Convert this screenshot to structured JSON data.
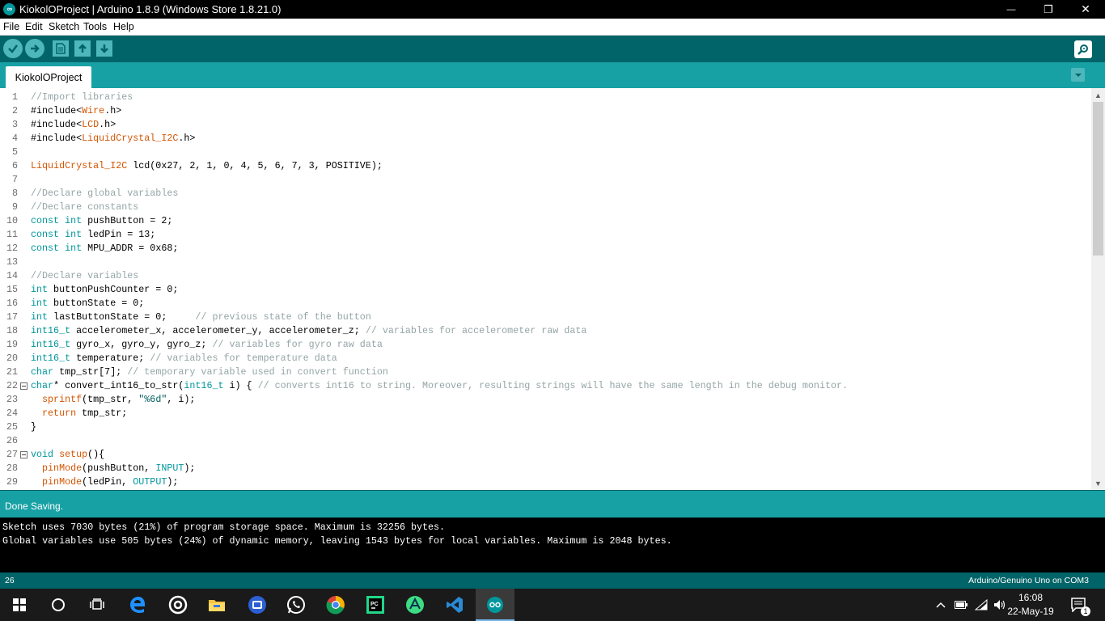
{
  "window": {
    "title": "KiokolOProject | Arduino 1.8.9 (Windows Store 1.8.21.0)",
    "logo_text": "∞",
    "minimize": "—",
    "restore": "❐",
    "close": "✕"
  },
  "menu": [
    "File",
    "Edit",
    "Sketch",
    "Tools",
    "Help"
  ],
  "tab": {
    "label": "KiokolOProject"
  },
  "colors": {
    "teal_dark": "#006468",
    "teal": "#17a1a5",
    "keyword": "#00979c",
    "function": "#d35400",
    "comment": "#95a5a6"
  },
  "code_lines": [
    {
      "n": "1",
      "tokens": [
        {
          "c": "com",
          "t": "//Import libraries"
        }
      ]
    },
    {
      "n": "2",
      "tokens": [
        {
          "c": "",
          "t": "#include<"
        },
        {
          "c": "fn",
          "t": "Wire"
        },
        {
          "c": "",
          "t": ".h>"
        }
      ]
    },
    {
      "n": "3",
      "tokens": [
        {
          "c": "",
          "t": "#include<"
        },
        {
          "c": "fn",
          "t": "LCD"
        },
        {
          "c": "",
          "t": ".h>"
        }
      ]
    },
    {
      "n": "4",
      "tokens": [
        {
          "c": "",
          "t": "#include<"
        },
        {
          "c": "fn",
          "t": "LiquidCrystal_I2C"
        },
        {
          "c": "",
          "t": ".h>"
        }
      ]
    },
    {
      "n": "5",
      "tokens": []
    },
    {
      "n": "6",
      "tokens": [
        {
          "c": "fn",
          "t": "LiquidCrystal_I2C"
        },
        {
          "c": "",
          "t": " lcd(0x27, 2, 1, 0, 4, 5, 6, 7, 3, POSITIVE);"
        }
      ]
    },
    {
      "n": "7",
      "tokens": []
    },
    {
      "n": "8",
      "tokens": [
        {
          "c": "com",
          "t": "//Declare global variables"
        }
      ]
    },
    {
      "n": "9",
      "tokens": [
        {
          "c": "com",
          "t": "//Declare constants"
        }
      ]
    },
    {
      "n": "10",
      "tokens": [
        {
          "c": "kw",
          "t": "const"
        },
        {
          "c": "",
          "t": " "
        },
        {
          "c": "kw",
          "t": "int"
        },
        {
          "c": "",
          "t": " pushButton = 2;"
        }
      ]
    },
    {
      "n": "11",
      "tokens": [
        {
          "c": "kw",
          "t": "const"
        },
        {
          "c": "",
          "t": " "
        },
        {
          "c": "kw",
          "t": "int"
        },
        {
          "c": "",
          "t": " ledPin = 13;"
        }
      ]
    },
    {
      "n": "12",
      "tokens": [
        {
          "c": "kw",
          "t": "const"
        },
        {
          "c": "",
          "t": " "
        },
        {
          "c": "kw",
          "t": "int"
        },
        {
          "c": "",
          "t": " MPU_ADDR = 0x68;"
        }
      ]
    },
    {
      "n": "13",
      "tokens": []
    },
    {
      "n": "14",
      "tokens": [
        {
          "c": "com",
          "t": "//Declare variables"
        }
      ]
    },
    {
      "n": "15",
      "tokens": [
        {
          "c": "kw",
          "t": "int"
        },
        {
          "c": "",
          "t": " buttonPushCounter = 0;"
        }
      ]
    },
    {
      "n": "16",
      "tokens": [
        {
          "c": "kw",
          "t": "int"
        },
        {
          "c": "",
          "t": " buttonState = 0;"
        }
      ]
    },
    {
      "n": "17",
      "tokens": [
        {
          "c": "kw",
          "t": "int"
        },
        {
          "c": "",
          "t": " lastButtonState = 0;     "
        },
        {
          "c": "com",
          "t": "// previous state of the button"
        }
      ]
    },
    {
      "n": "18",
      "tokens": [
        {
          "c": "kw",
          "t": "int16_t"
        },
        {
          "c": "",
          "t": " accelerometer_x, accelerometer_y, accelerometer_z; "
        },
        {
          "c": "com",
          "t": "// variables for accelerometer raw data"
        }
      ]
    },
    {
      "n": "19",
      "tokens": [
        {
          "c": "kw",
          "t": "int16_t"
        },
        {
          "c": "",
          "t": " gyro_x, gyro_y, gyro_z; "
        },
        {
          "c": "com",
          "t": "// variables for gyro raw data"
        }
      ]
    },
    {
      "n": "20",
      "tokens": [
        {
          "c": "kw",
          "t": "int16_t"
        },
        {
          "c": "",
          "t": " temperature; "
        },
        {
          "c": "com",
          "t": "// variables for temperature data"
        }
      ]
    },
    {
      "n": "21",
      "tokens": [
        {
          "c": "kw",
          "t": "char"
        },
        {
          "c": "",
          "t": " tmp_str[7]; "
        },
        {
          "c": "com",
          "t": "// temporary variable used in convert function"
        }
      ]
    },
    {
      "n": "22",
      "fold": true,
      "tokens": [
        {
          "c": "kw",
          "t": "char"
        },
        {
          "c": "",
          "t": "* convert_int16_to_str("
        },
        {
          "c": "kw",
          "t": "int16_t"
        },
        {
          "c": "",
          "t": " i) { "
        },
        {
          "c": "com",
          "t": "// converts int16 to string. Moreover, resulting strings will have the same length in the debug monitor."
        }
      ]
    },
    {
      "n": "23",
      "tokens": [
        {
          "c": "",
          "t": "  "
        },
        {
          "c": "fn",
          "t": "sprintf"
        },
        {
          "c": "",
          "t": "(tmp_str, "
        },
        {
          "c": "str",
          "t": "\"%6d\""
        },
        {
          "c": "",
          "t": ", i);"
        }
      ]
    },
    {
      "n": "24",
      "tokens": [
        {
          "c": "",
          "t": "  "
        },
        {
          "c": "fn",
          "t": "return"
        },
        {
          "c": "",
          "t": " tmp_str;"
        }
      ]
    },
    {
      "n": "25",
      "tokens": [
        {
          "c": "",
          "t": "}"
        }
      ]
    },
    {
      "n": "26",
      "tokens": []
    },
    {
      "n": "27",
      "fold": true,
      "tokens": [
        {
          "c": "kw",
          "t": "void"
        },
        {
          "c": "",
          "t": " "
        },
        {
          "c": "fn",
          "t": "setup"
        },
        {
          "c": "",
          "t": "(){"
        }
      ]
    },
    {
      "n": "28",
      "tokens": [
        {
          "c": "",
          "t": "  "
        },
        {
          "c": "fn",
          "t": "pinMode"
        },
        {
          "c": "",
          "t": "(pushButton, "
        },
        {
          "c": "lit",
          "t": "INPUT"
        },
        {
          "c": "",
          "t": ");"
        }
      ]
    },
    {
      "n": "29",
      "tokens": [
        {
          "c": "",
          "t": "  "
        },
        {
          "c": "fn",
          "t": "pinMode"
        },
        {
          "c": "",
          "t": "(ledPin, "
        },
        {
          "c": "lit",
          "t": "OUTPUT"
        },
        {
          "c": "",
          "t": ");"
        }
      ]
    }
  ],
  "status": {
    "message": "Done Saving."
  },
  "console": {
    "line1": "Sketch uses 7030 bytes (21%) of program storage space. Maximum is 32256 bytes.",
    "line2": "Global variables use 505 bytes (24%) of dynamic memory, leaving 1543 bytes for local variables. Maximum is 2048 bytes."
  },
  "footer": {
    "line_number": "26",
    "board": "Arduino/Genuino Uno on COM3"
  },
  "clock": {
    "time": "16:08",
    "date": "22-May-19"
  },
  "notifications": {
    "count": "1"
  }
}
